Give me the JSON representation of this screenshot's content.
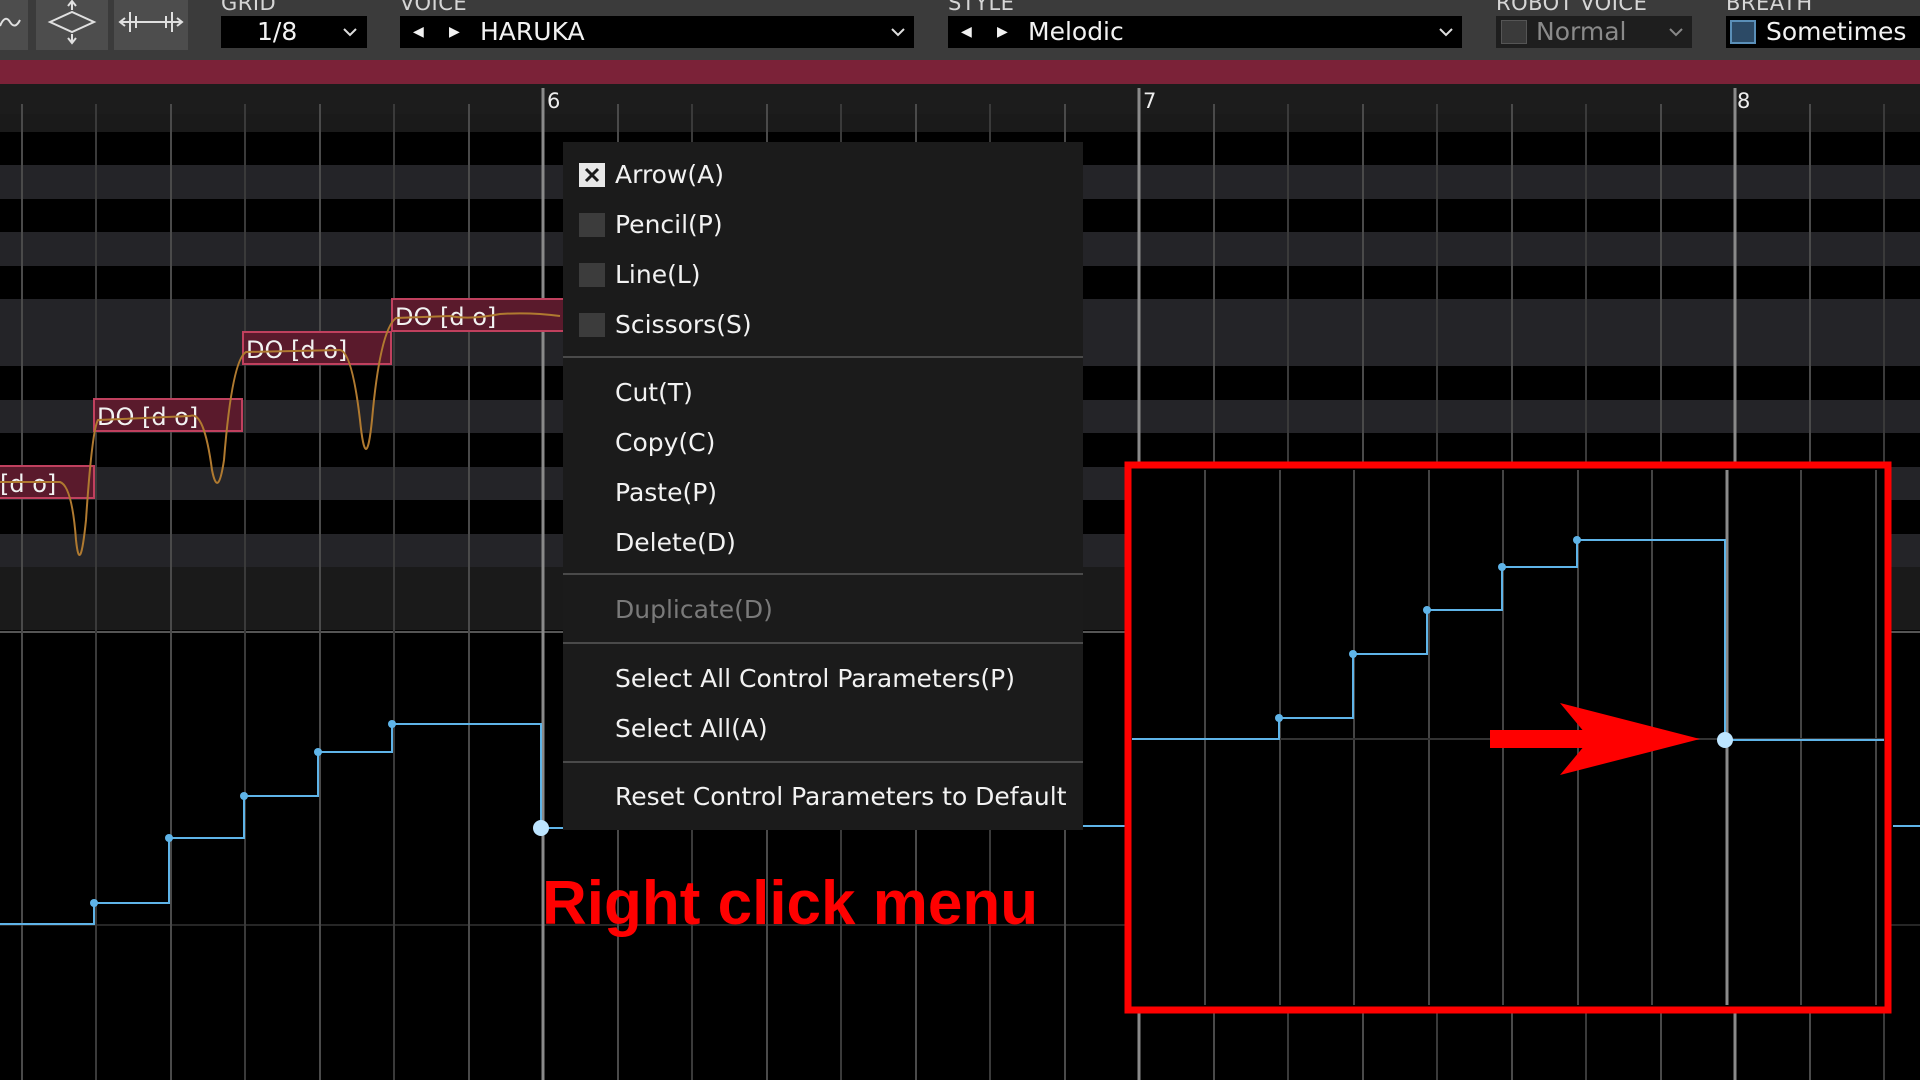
{
  "toolbar": {
    "grid": {
      "label": "GRID",
      "value": "1/8"
    },
    "voice": {
      "label": "VOICE",
      "value": "HARUKA"
    },
    "style": {
      "label": "STYLE",
      "value": "Melodic"
    },
    "robot_voice": {
      "label": "ROBOT VOICE",
      "value": "Normal"
    },
    "breath": {
      "label": "BREATH",
      "value": "Sometimes"
    }
  },
  "ruler": {
    "measures": [
      "6",
      "7",
      "8"
    ]
  },
  "notes": [
    {
      "lyric": "[d o]"
    },
    {
      "lyric": "DO [d o]"
    },
    {
      "lyric": "DO [d o]"
    },
    {
      "lyric": "DO [d o]"
    }
  ],
  "context_menu": {
    "tools": [
      {
        "label": "Arrow(A)",
        "checked": true
      },
      {
        "label": "Pencil(P)",
        "checked": false
      },
      {
        "label": "Line(L)",
        "checked": false
      },
      {
        "label": "Scissors(S)",
        "checked": false
      }
    ],
    "edit": [
      "Cut(T)",
      "Copy(C)",
      "Paste(P)",
      "Delete(D)"
    ],
    "duplicate": "Duplicate(D)",
    "select": [
      "Select All Control Parameters(P)",
      "Select All(A)"
    ],
    "reset": "Reset Control Parameters to Default"
  },
  "annotation": {
    "text": "Right click menu",
    "color": "#ff0000"
  },
  "colors": {
    "accent": "#7b2238",
    "note_fill": "#5a1a2c",
    "note_border": "#c0405e",
    "param_line": "#5fb4e8",
    "pitch_curve": "#b07a30"
  }
}
